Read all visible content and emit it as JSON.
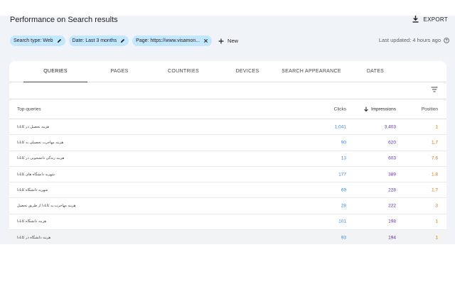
{
  "header": {
    "title": "Performance on Search results",
    "export_label": "EXPORT"
  },
  "filters": {
    "chips": [
      {
        "label": "Search type: Web"
      },
      {
        "label": "Date: Last 3 months"
      },
      {
        "label": "Page: https://www.visamon..."
      }
    ],
    "new_label": "New",
    "last_updated": "Last updated: 4 hours ago"
  },
  "tabs": [
    {
      "label": "QUERIES",
      "active": true
    },
    {
      "label": "PAGES"
    },
    {
      "label": "COUNTRIES"
    },
    {
      "label": "DEVICES"
    },
    {
      "label": "SEARCH APPEARANCE"
    },
    {
      "label": "DATES"
    }
  ],
  "table": {
    "headers": {
      "query": "Top queries",
      "clicks": "Clicks",
      "impressions": "Impressions",
      "position": "Position"
    },
    "rows": [
      {
        "query": "هزینه تحصیل در کانادا",
        "clicks": "1,041",
        "impressions": "3,403",
        "position": "1"
      },
      {
        "query": "هزینه مهاجرت تحصیلی به کانادا",
        "clicks": "90",
        "impressions": "620",
        "position": "1.7"
      },
      {
        "query": "هزینه زندگی دانشجویی در کانادا",
        "clicks": "13",
        "impressions": "603",
        "position": "7.6"
      },
      {
        "query": "شهریه دانشگاه های کانادا",
        "clicks": "177",
        "impressions": "389",
        "position": "1.8"
      },
      {
        "query": "شهریه دانشگاه کانادا",
        "clicks": "69",
        "impressions": "228",
        "position": "1.7"
      },
      {
        "query": "هزینه مهاجرت به کانادا از طریق تحصیل",
        "clicks": "28",
        "impressions": "222",
        "position": "3"
      },
      {
        "query": "هزینه دانشگاه کانادا",
        "clicks": "101",
        "impressions": "198",
        "position": "1"
      },
      {
        "query": "هزینه دانشگاه در کانادا",
        "clicks": "93",
        "impressions": "194",
        "position": "1"
      }
    ]
  },
  "colors": {
    "clicks": "#4285f4",
    "impressions": "#5e35b1",
    "position": "#e37400",
    "chip": "#c2e7ff",
    "panel_bg": "#f0f4f9"
  }
}
